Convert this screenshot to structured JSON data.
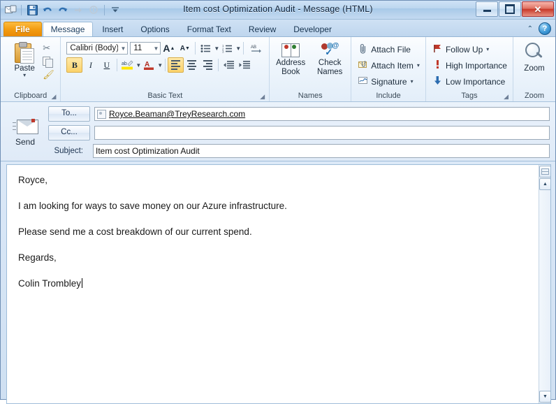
{
  "window": {
    "title": "Item cost Optimization Audit  -  Message (HTML)",
    "quick_access": [
      {
        "name": "outlook-icon",
        "glyph": "✉"
      },
      {
        "name": "save-icon",
        "glyph": "💾"
      },
      {
        "name": "undo-icon",
        "glyph": "↶"
      },
      {
        "name": "redo-icon",
        "glyph": "↷"
      },
      {
        "name": "forward-icon",
        "glyph": "➤"
      },
      {
        "name": "up-icon",
        "glyph": "↑"
      },
      {
        "name": "customize-qat-icon",
        "glyph": "▾"
      }
    ],
    "controls": {
      "minimize": "–",
      "maximize": "□",
      "close": "✕"
    }
  },
  "tabs": [
    {
      "label": "File",
      "kind": "file"
    },
    {
      "label": "Message",
      "kind": "active"
    },
    {
      "label": "Insert",
      "kind": "normal"
    },
    {
      "label": "Options",
      "kind": "normal"
    },
    {
      "label": "Format Text",
      "kind": "normal"
    },
    {
      "label": "Review",
      "kind": "normal"
    },
    {
      "label": "Developer",
      "kind": "normal"
    }
  ],
  "tabstrip_right": {
    "collapse": "⌃",
    "help": "?"
  },
  "ribbon": {
    "clipboard": {
      "group_label": "Clipboard",
      "paste_label": "Paste",
      "paste_caret": "▾",
      "cut_label": "Cut",
      "copy_label": "Copy",
      "format_painter_label": "Format Painter"
    },
    "basic_text": {
      "group_label": "Basic Text",
      "font_name": "Calibri (Body)",
      "font_size": "11",
      "grow_font": "A",
      "shrink_font": "A",
      "bullets_label": "Bullets",
      "numbering_label": "Numbering",
      "text_direction_label": "Text Direction",
      "bold": "B",
      "italic": "I",
      "underline": "U",
      "highlight": "ab",
      "font_color": "A",
      "align_left_label": "Align Left",
      "center_label": "Center",
      "align_right_label": "Align Right",
      "decrease_indent_label": "Decrease Indent",
      "increase_indent_label": "Increase Indent",
      "dialog_launcher": "⬌"
    },
    "names": {
      "group_label": "Names",
      "address_book": "Address\nBook",
      "check_names": "Check\nNames"
    },
    "include": {
      "group_label": "Include",
      "items": [
        {
          "label": "Attach File",
          "icon": "paperclip-icon",
          "glyph": "📎",
          "caret": ""
        },
        {
          "label": "Attach Item",
          "icon": "attach-item-icon",
          "glyph": "📎",
          "caret": "▾"
        },
        {
          "label": "Signature",
          "icon": "signature-icon",
          "glyph": "✎",
          "caret": "▾"
        }
      ]
    },
    "tags": {
      "group_label": "Tags",
      "dialog_launcher": "⬌",
      "items": [
        {
          "label": "Follow Up",
          "icon": "flag-icon",
          "glyph": "⚑",
          "caret": "▾",
          "color": "#c0392b"
        },
        {
          "label": "High Importance",
          "icon": "exclamation-icon",
          "glyph": "!",
          "caret": "",
          "color": "#c0392b"
        },
        {
          "label": "Low Importance",
          "icon": "down-arrow-icon",
          "glyph": "↓",
          "caret": "",
          "color": "#2b6cb0"
        }
      ]
    },
    "zoom": {
      "group_label": "Zoom",
      "button_label": "Zoom"
    }
  },
  "compose": {
    "send_label": "Send",
    "to_button": "To...",
    "cc_button": "Cc...",
    "subject_label": "Subject:",
    "to_value": "Royce.Beaman@TreyResearch.com",
    "cc_value": "",
    "subject_value": "Item cost Optimization Audit"
  },
  "body": {
    "paragraphs": [
      "Royce,",
      "I am looking for ways to save money on our Azure infrastructure.",
      "Please send me a cost breakdown of our current spend.",
      "Regards,",
      "Colin Trombley"
    ],
    "cursor_after_last": true
  },
  "scrollbar": {
    "up": "▲",
    "down": "▼",
    "split": "☰"
  },
  "colors": {
    "accent_orange": "#f39c12",
    "title_blue": "#a8c9e8",
    "close_red": "#c8392a",
    "highlight_yellow": "#fbd26a"
  }
}
